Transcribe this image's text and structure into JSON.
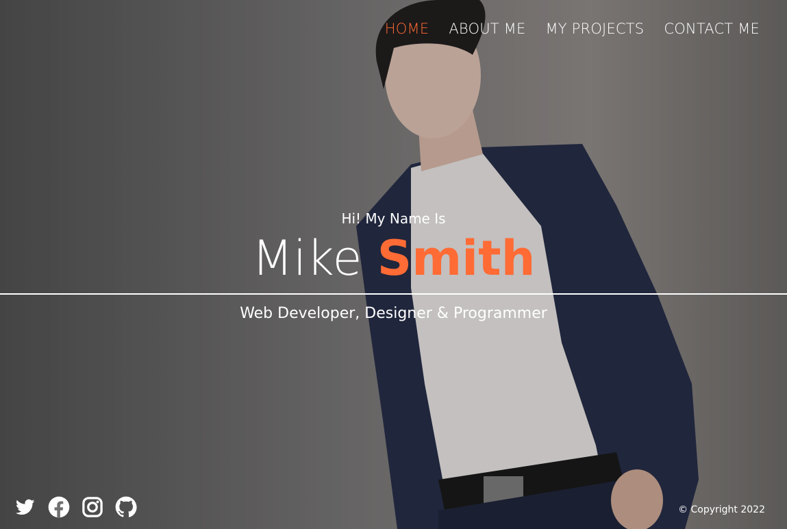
{
  "nav": {
    "items": [
      {
        "label": "HOME",
        "active": true
      },
      {
        "label": "ABOUT ME",
        "active": false
      },
      {
        "label": "MY PROJECTS",
        "active": false
      },
      {
        "label": "CONTACT ME",
        "active": false
      }
    ]
  },
  "hero": {
    "intro": "Hi! My Name Is",
    "first_name": "Mike",
    "last_name": "Smith",
    "tagline": "Web Developer, Designer & Programmer"
  },
  "social": {
    "icons": [
      "twitter-icon",
      "facebook-icon",
      "instagram-icon",
      "github-icon"
    ]
  },
  "footer": {
    "copyright": "© Copyright 2022"
  },
  "colors": {
    "accent": "#ff6b35",
    "text": "#ffffff"
  }
}
